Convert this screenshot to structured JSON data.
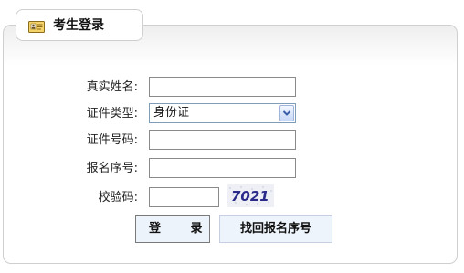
{
  "tab": {
    "title": "考生登录",
    "icon": "id-card-icon"
  },
  "form": {
    "name_label": "真实姓名:",
    "id_type_label": "证件类型:",
    "id_type_value": "身份证",
    "id_number_label": "证件号码:",
    "serial_label": "报名序号:",
    "captcha_label": "校验码:",
    "captcha_text": "7021"
  },
  "buttons": {
    "login_label": "登 录",
    "recover_label": "找回报名序号"
  },
  "colors": {
    "panel_border": "#cfcfcf",
    "button_bg": "#eef4fb",
    "captcha_text": "#2a2a8a"
  }
}
